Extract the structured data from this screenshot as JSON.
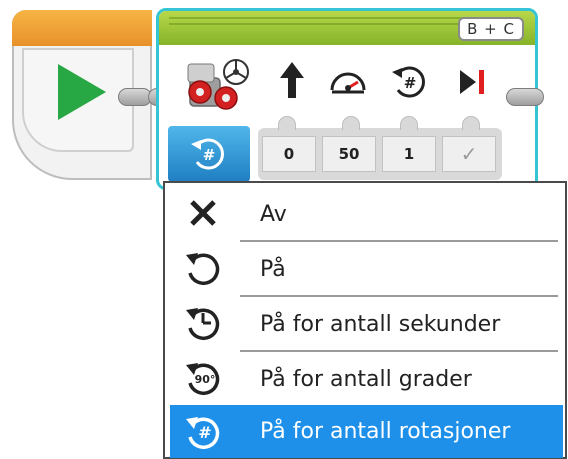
{
  "motor_block": {
    "ports": "B + C",
    "params": [
      "0",
      "50",
      "1",
      "✓"
    ]
  },
  "menu": {
    "items": [
      {
        "label": "Av",
        "icon": "close-icon"
      },
      {
        "label": "På",
        "icon": "rotate-on-icon"
      },
      {
        "label": "På for antall sekunder",
        "icon": "timer-icon"
      },
      {
        "label": "På for antall grader",
        "icon": "degrees-icon",
        "icon_text": "90°"
      },
      {
        "label": "På for antall rotasjoner",
        "icon": "rotations-icon",
        "icon_text": "#"
      }
    ],
    "selected_index": 4
  },
  "colors": {
    "start_accent": "#e8912a",
    "motor_accent": "#86b32a",
    "selection": "#1e90ea",
    "play": "#28a745"
  }
}
